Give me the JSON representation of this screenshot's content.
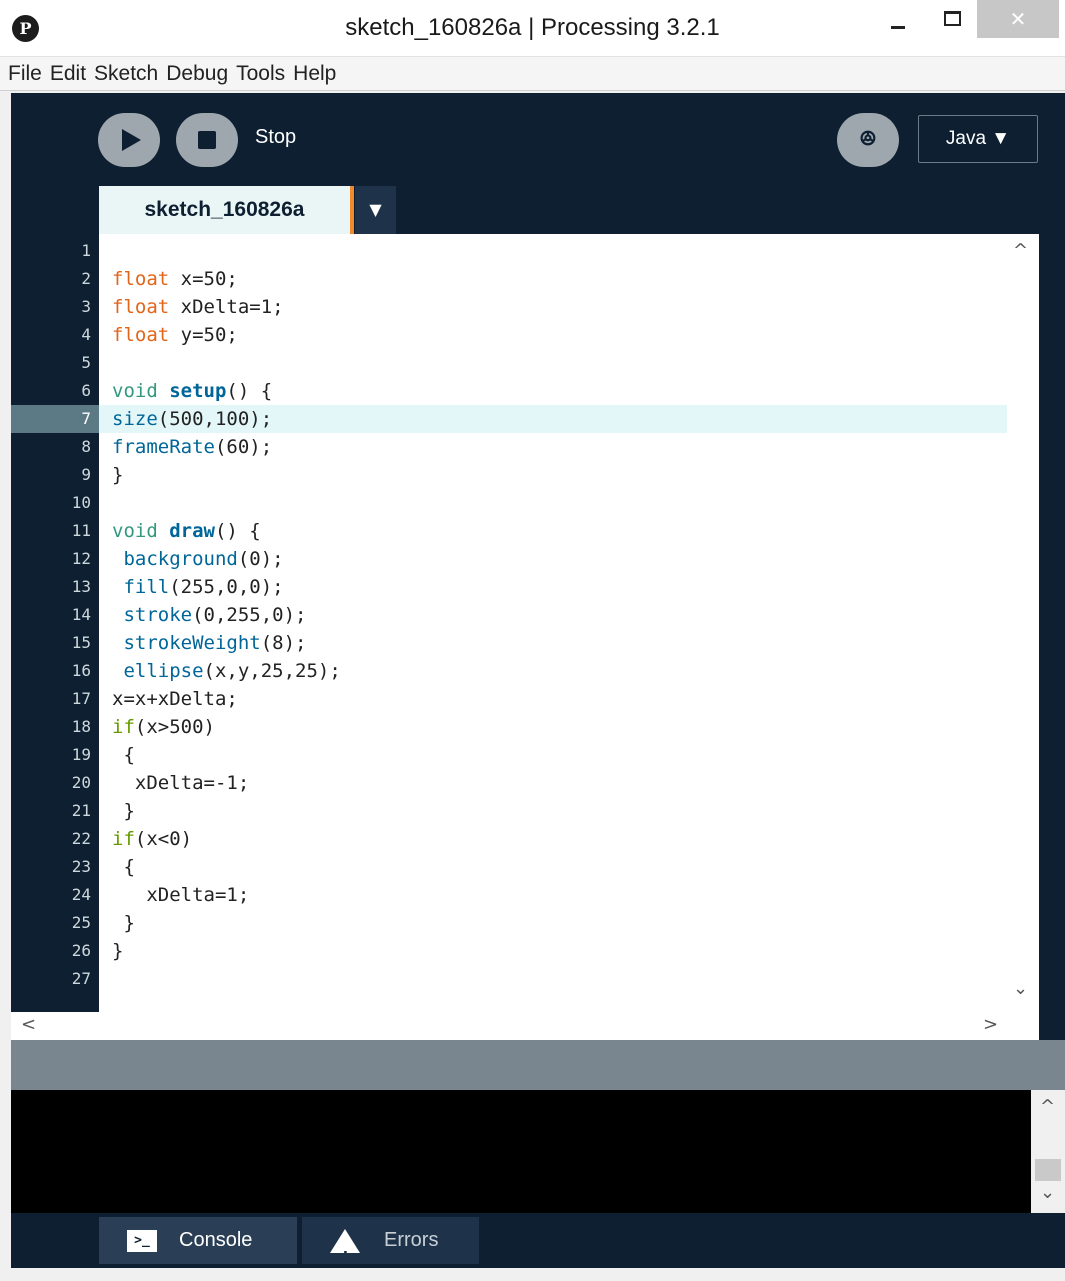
{
  "window": {
    "title": "sketch_160826a | Processing 3.2.1",
    "icon_glyph": "P",
    "minimize_icon": "minimize-icon",
    "maximize_icon": "maximize-icon",
    "close_glyph": "✕"
  },
  "menu": [
    "File",
    "Edit",
    "Sketch",
    "Debug",
    "Tools",
    "Help"
  ],
  "toolbar": {
    "run_icon": "play-icon",
    "stop_icon": "stop-icon",
    "stop_label": "Stop",
    "debug_icon": "debugger-icon",
    "debug_glyph": "ꔮ",
    "mode": "Java ▼"
  },
  "tab": {
    "label": "sketch_160826a",
    "menu_glyph": "▼"
  },
  "editor": {
    "active_line": 7,
    "lines": [
      {
        "n": "1",
        "tokens": []
      },
      {
        "n": "2",
        "tokens": [
          {
            "t": "float",
            "c": "kw-type"
          },
          {
            "t": " x=50;"
          }
        ]
      },
      {
        "n": "3",
        "tokens": [
          {
            "t": "float",
            "c": "kw-type"
          },
          {
            "t": " xDelta=1;"
          }
        ]
      },
      {
        "n": "4",
        "tokens": [
          {
            "t": "float",
            "c": "kw-type"
          },
          {
            "t": " y=50;"
          }
        ]
      },
      {
        "n": "5",
        "tokens": []
      },
      {
        "n": "6",
        "tokens": [
          {
            "t": "void",
            "c": "kw-void"
          },
          {
            "t": " "
          },
          {
            "t": "setup",
            "c": "fn-def"
          },
          {
            "t": "() {"
          }
        ]
      },
      {
        "n": "7",
        "tokens": [
          {
            "t": "size",
            "c": "fn"
          },
          {
            "t": "(500,100);"
          }
        ]
      },
      {
        "n": "8",
        "tokens": [
          {
            "t": "frameRate",
            "c": "fn"
          },
          {
            "t": "(60);"
          }
        ]
      },
      {
        "n": "9",
        "tokens": [
          {
            "t": "}"
          }
        ]
      },
      {
        "n": "10",
        "tokens": []
      },
      {
        "n": "11",
        "tokens": [
          {
            "t": "void",
            "c": "kw-void"
          },
          {
            "t": " "
          },
          {
            "t": "draw",
            "c": "fn-def"
          },
          {
            "t": "() {"
          }
        ]
      },
      {
        "n": "12",
        "tokens": [
          {
            "t": " "
          },
          {
            "t": "background",
            "c": "fn"
          },
          {
            "t": "(0);"
          }
        ]
      },
      {
        "n": "13",
        "tokens": [
          {
            "t": " "
          },
          {
            "t": "fill",
            "c": "fn"
          },
          {
            "t": "(255,0,0);"
          }
        ]
      },
      {
        "n": "14",
        "tokens": [
          {
            "t": " "
          },
          {
            "t": "stroke",
            "c": "fn"
          },
          {
            "t": "(0,255,0);"
          }
        ]
      },
      {
        "n": "15",
        "tokens": [
          {
            "t": " "
          },
          {
            "t": "strokeWeight",
            "c": "fn"
          },
          {
            "t": "(8);"
          }
        ]
      },
      {
        "n": "16",
        "tokens": [
          {
            "t": " "
          },
          {
            "t": "ellipse",
            "c": "fn"
          },
          {
            "t": "(x,y,25,25);"
          }
        ]
      },
      {
        "n": "17",
        "tokens": [
          {
            "t": "x=x+xDelta;"
          }
        ]
      },
      {
        "n": "18",
        "tokens": [
          {
            "t": "if",
            "c": "kw-ctrl"
          },
          {
            "t": "(x>500)"
          }
        ]
      },
      {
        "n": "19",
        "tokens": [
          {
            "t": " {"
          }
        ]
      },
      {
        "n": "20",
        "tokens": [
          {
            "t": "  xDelta=-1;"
          }
        ]
      },
      {
        "n": "21",
        "tokens": [
          {
            "t": " }"
          }
        ]
      },
      {
        "n": "22",
        "tokens": [
          {
            "t": "if",
            "c": "kw-ctrl"
          },
          {
            "t": "(x<0)"
          }
        ]
      },
      {
        "n": "23",
        "tokens": [
          {
            "t": " {"
          }
        ]
      },
      {
        "n": "24",
        "tokens": [
          {
            "t": "   xDelta=1;"
          }
        ]
      },
      {
        "n": "25",
        "tokens": [
          {
            "t": " }"
          }
        ]
      },
      {
        "n": "26",
        "tokens": [
          {
            "t": "}"
          }
        ]
      },
      {
        "n": "27",
        "tokens": []
      }
    ]
  },
  "scroll": {
    "up": "^",
    "down": "⌄",
    "left": "<",
    "right": ">"
  },
  "bottom_tabs": {
    "console_label": "Console",
    "console_glyph": ">_",
    "errors_label": "Errors"
  },
  "colors": {
    "ide_background": "#0d1f31",
    "tab_accent": "#f1892d",
    "keyword_type": "#e2661a",
    "keyword_void": "#33997e",
    "function": "#006699",
    "control": "#669900",
    "current_line": "#e3f7f8"
  }
}
